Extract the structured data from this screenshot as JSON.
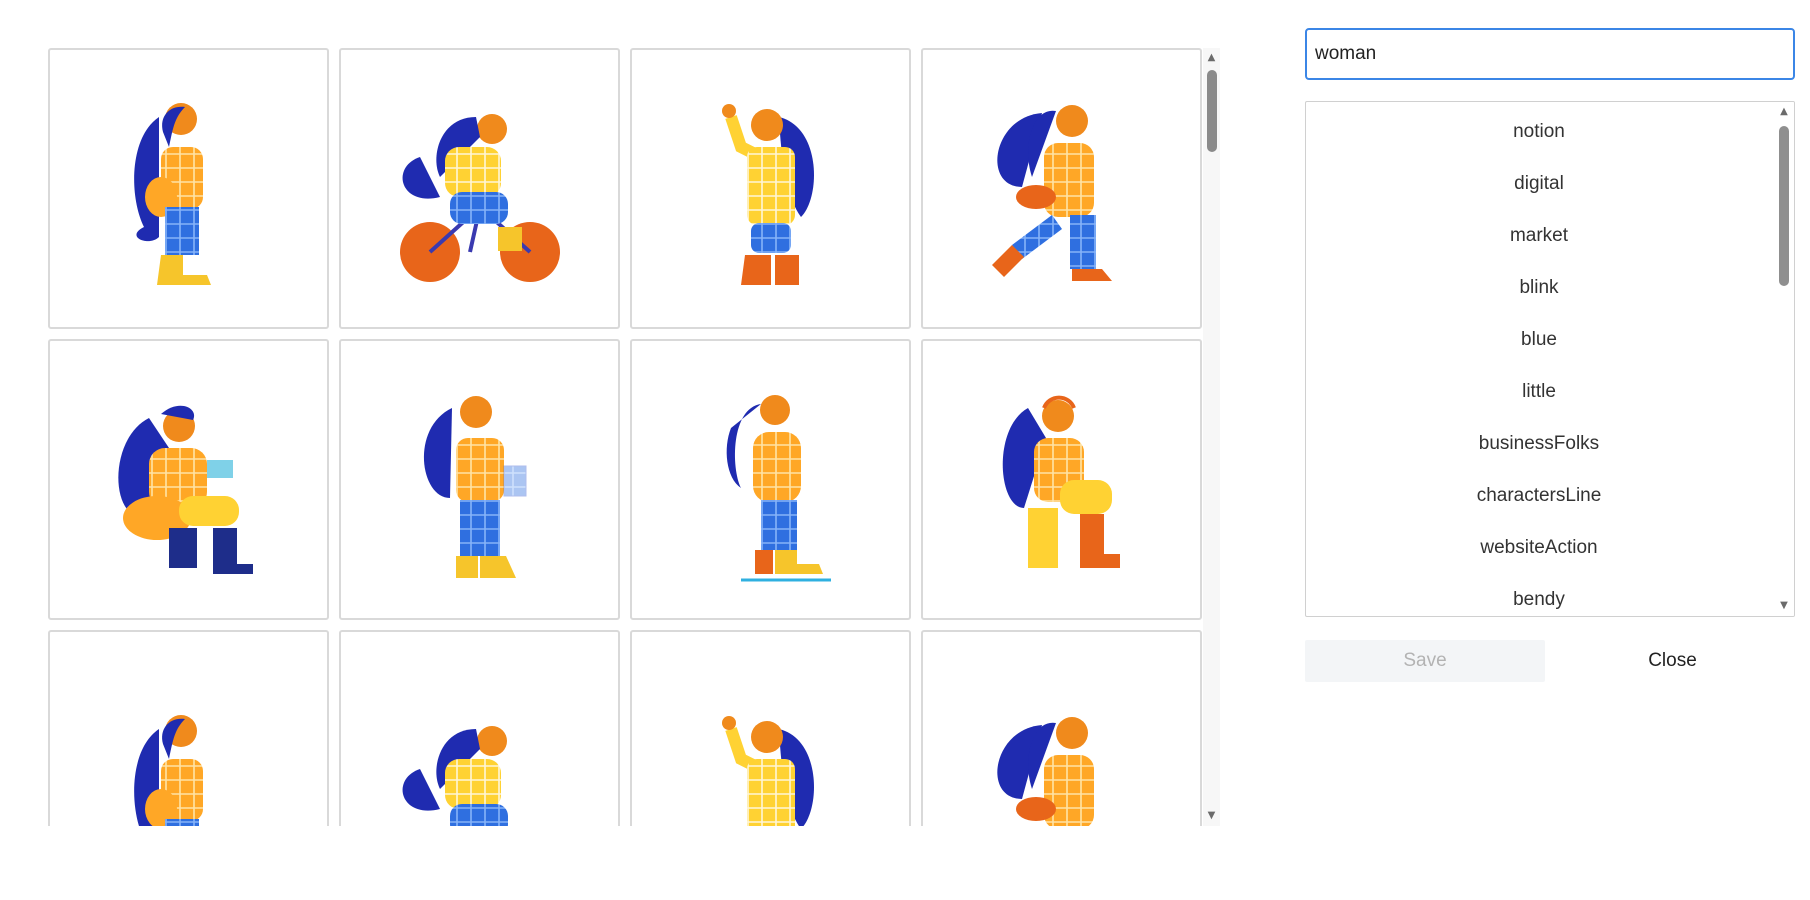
{
  "search": {
    "value": "woman"
  },
  "tags": [
    "notion",
    "digital",
    "market",
    "blink",
    "blue",
    "little",
    "businessFolks",
    "charactersLine",
    "websiteAction",
    "bendy"
  ],
  "actions": {
    "save_label": "Save",
    "close_label": "Close"
  },
  "palette": {
    "hair": "#1f2bb0",
    "skin": "#f08a1c",
    "plaid_orange": "#ffa726",
    "plaid_yellow": "#ffd233",
    "denim": "#2f6fe0",
    "boot_yellow": "#f6c52b",
    "boot_orange": "#e8651a"
  },
  "gallery": {
    "tiles": [
      {
        "icon": "woman-standing-illustration"
      },
      {
        "icon": "woman-cycling-illustration"
      },
      {
        "icon": "woman-waving-illustration"
      },
      {
        "icon": "woman-walking-illustration"
      },
      {
        "icon": "woman-reading-illustration"
      },
      {
        "icon": "woman-holding-basket-illustration"
      },
      {
        "icon": "woman-looking-up-illustration"
      },
      {
        "icon": "woman-sitting-headphones-illustration"
      },
      {
        "icon": "woman-reading-book-illustration"
      },
      {
        "icon": "woman-raising-fist-illustration"
      },
      {
        "icon": "woman-thinking-illustration"
      },
      {
        "icon": "woman-sitting-chair-illustration"
      }
    ]
  }
}
